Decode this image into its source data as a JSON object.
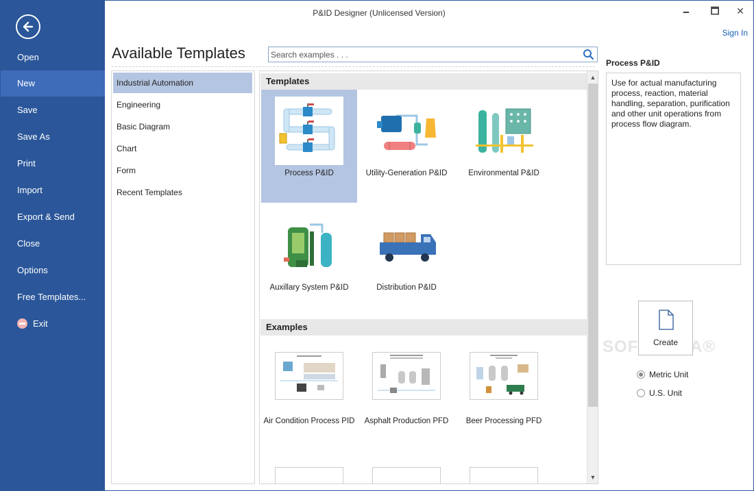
{
  "window": {
    "title": "P&ID Designer (Unlicensed Version)",
    "controls": {
      "minimize": "🗕",
      "maximize": "🗖",
      "close": "✕"
    },
    "sign_in": "Sign In"
  },
  "sidebar": {
    "back_icon": "back-arrow-icon",
    "items": [
      {
        "label": "Open",
        "active": false
      },
      {
        "label": "New",
        "active": true
      },
      {
        "label": "Save",
        "active": false
      },
      {
        "label": "Save As",
        "active": false
      },
      {
        "label": "Print",
        "active": false
      },
      {
        "label": "Import",
        "active": false
      },
      {
        "label": "Export & Send",
        "active": false
      },
      {
        "label": "Close",
        "active": false
      },
      {
        "label": "Options",
        "active": false
      },
      {
        "label": "Free Templates...",
        "active": false
      },
      {
        "label": "Exit",
        "active": false,
        "icon": "exit-icon"
      }
    ]
  },
  "main": {
    "heading": "Available Templates",
    "search": {
      "placeholder": "Search examples . . .",
      "value": ""
    },
    "categories": [
      {
        "label": "Industrial Automation",
        "active": true
      },
      {
        "label": "Engineering",
        "active": false
      },
      {
        "label": "Basic Diagram",
        "active": false
      },
      {
        "label": "Chart",
        "active": false
      },
      {
        "label": "Form",
        "active": false
      },
      {
        "label": "Recent Templates",
        "active": false
      }
    ],
    "templates_header": "Templates",
    "templates": [
      {
        "label": "Process P&ID",
        "selected": true
      },
      {
        "label": "Utility-Generation P&ID",
        "selected": false
      },
      {
        "label": "Environmental P&ID",
        "selected": false
      },
      {
        "label": "Auxillary System P&ID",
        "selected": false
      },
      {
        "label": "Distribution P&ID",
        "selected": false
      }
    ],
    "examples_header": "Examples",
    "examples": [
      {
        "label": "Air Condition Process PID"
      },
      {
        "label": "Asphalt Production PFD"
      },
      {
        "label": "Beer Processing PFD"
      }
    ]
  },
  "detail": {
    "title": "Process P&ID",
    "description": "Use for actual manufacturing process, reaction, material handling, separation, purification and other unit operations from process flow diagram.",
    "create_label": "Create",
    "units": [
      {
        "label": "Metric Unit",
        "checked": true
      },
      {
        "label": "U.S. Unit",
        "checked": false
      }
    ]
  },
  "watermark": "SOFTPEDIA®",
  "colors": {
    "sidebar_bg": "#2b579a",
    "sidebar_active": "#3e6cb9",
    "selection": "#b4c5e2",
    "section_header": "#e8e8e8",
    "link": "#1a5fb4"
  }
}
